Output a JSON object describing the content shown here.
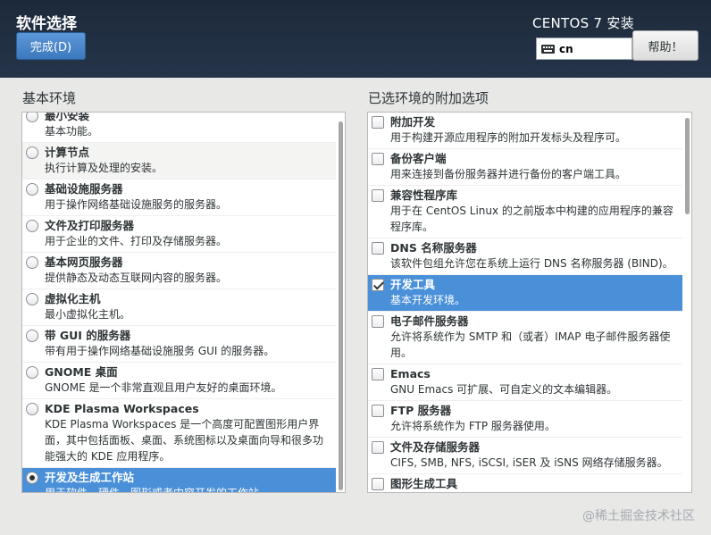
{
  "header": {
    "page_title": "软件选择",
    "done_label": "完成(D)",
    "product_title": "CENTOS 7 安装",
    "keyboard_layout": "cn",
    "help_label": "帮助！"
  },
  "base_environment": {
    "heading": "基本环境",
    "items": [
      {
        "title": "最小安装",
        "desc": "基本功能。",
        "selected": false
      },
      {
        "title": "计算节点",
        "desc": "执行计算及处理的安装。",
        "selected": false
      },
      {
        "title": "基础设施服务器",
        "desc": "用于操作网络基础设施服务的服务器。",
        "selected": false
      },
      {
        "title": "文件及打印服务器",
        "desc": "用于企业的文件、打印及存储服务器。",
        "selected": false
      },
      {
        "title": "基本网页服务器",
        "desc": "提供静态及动态互联网内容的服务器。",
        "selected": false
      },
      {
        "title": "虚拟化主机",
        "desc": "最小虚拟化主机。",
        "selected": false
      },
      {
        "title": "带 GUI 的服务器",
        "desc": "带有用于操作网络基础设施服务 GUI 的服务器。",
        "selected": false
      },
      {
        "title": "GNOME 桌面",
        "desc": "GNOME 是一个非常直观且用户友好的桌面环境。",
        "selected": false
      },
      {
        "title": "KDE Plasma Workspaces",
        "desc": "KDE Plasma Workspaces 是一个高度可配置图形用户界面，其中包括面板、桌面、系统图标以及桌面向导和很多功能强大的 KDE 应用程序。",
        "selected": false
      },
      {
        "title": "开发及生成工作站",
        "desc": "用于软件、硬件、图形或者内容开发的工作站。",
        "selected": true
      }
    ]
  },
  "addons": {
    "heading": "已选环境的附加选项",
    "items": [
      {
        "title": "附加开发",
        "desc": "用于构建开源应用程序的附加开发标头及程序可。",
        "checked": false
      },
      {
        "title": "备份客户端",
        "desc": "用来连接到备份服务器并进行备份的客户端工具。",
        "checked": false
      },
      {
        "title": "兼容性程序库",
        "desc": "用于在 CentOS Linux 的之前版本中构建的应用程序的兼容程序库。",
        "checked": false
      },
      {
        "title": "DNS 名称服务器",
        "desc": "该软件包组允许您在系统上运行 DNS 名称服务器 (BIND)。",
        "checked": false
      },
      {
        "title": "开发工具",
        "desc": "基本开发环境。",
        "checked": true
      },
      {
        "title": "电子邮件服务器",
        "desc": "允许将系统作为 SMTP 和（或者）IMAP 电子邮件服务器使用。",
        "checked": false
      },
      {
        "title": "Emacs",
        "desc": "GNU Emacs 可扩展、可自定义的文本编辑器。",
        "checked": false
      },
      {
        "title": "FTP 服务器",
        "desc": "允许将系统作为 FTP 服务器使用。",
        "checked": false
      },
      {
        "title": "文件及存储服务器",
        "desc": "CIFS, SMB, NFS, iSCSI, iSER 及 iSNS 网络存储服务器。",
        "checked": false
      },
      {
        "title": "图形生成工具",
        "desc": "",
        "checked": false
      }
    ]
  },
  "watermark": "@稀土掘金技术社区"
}
